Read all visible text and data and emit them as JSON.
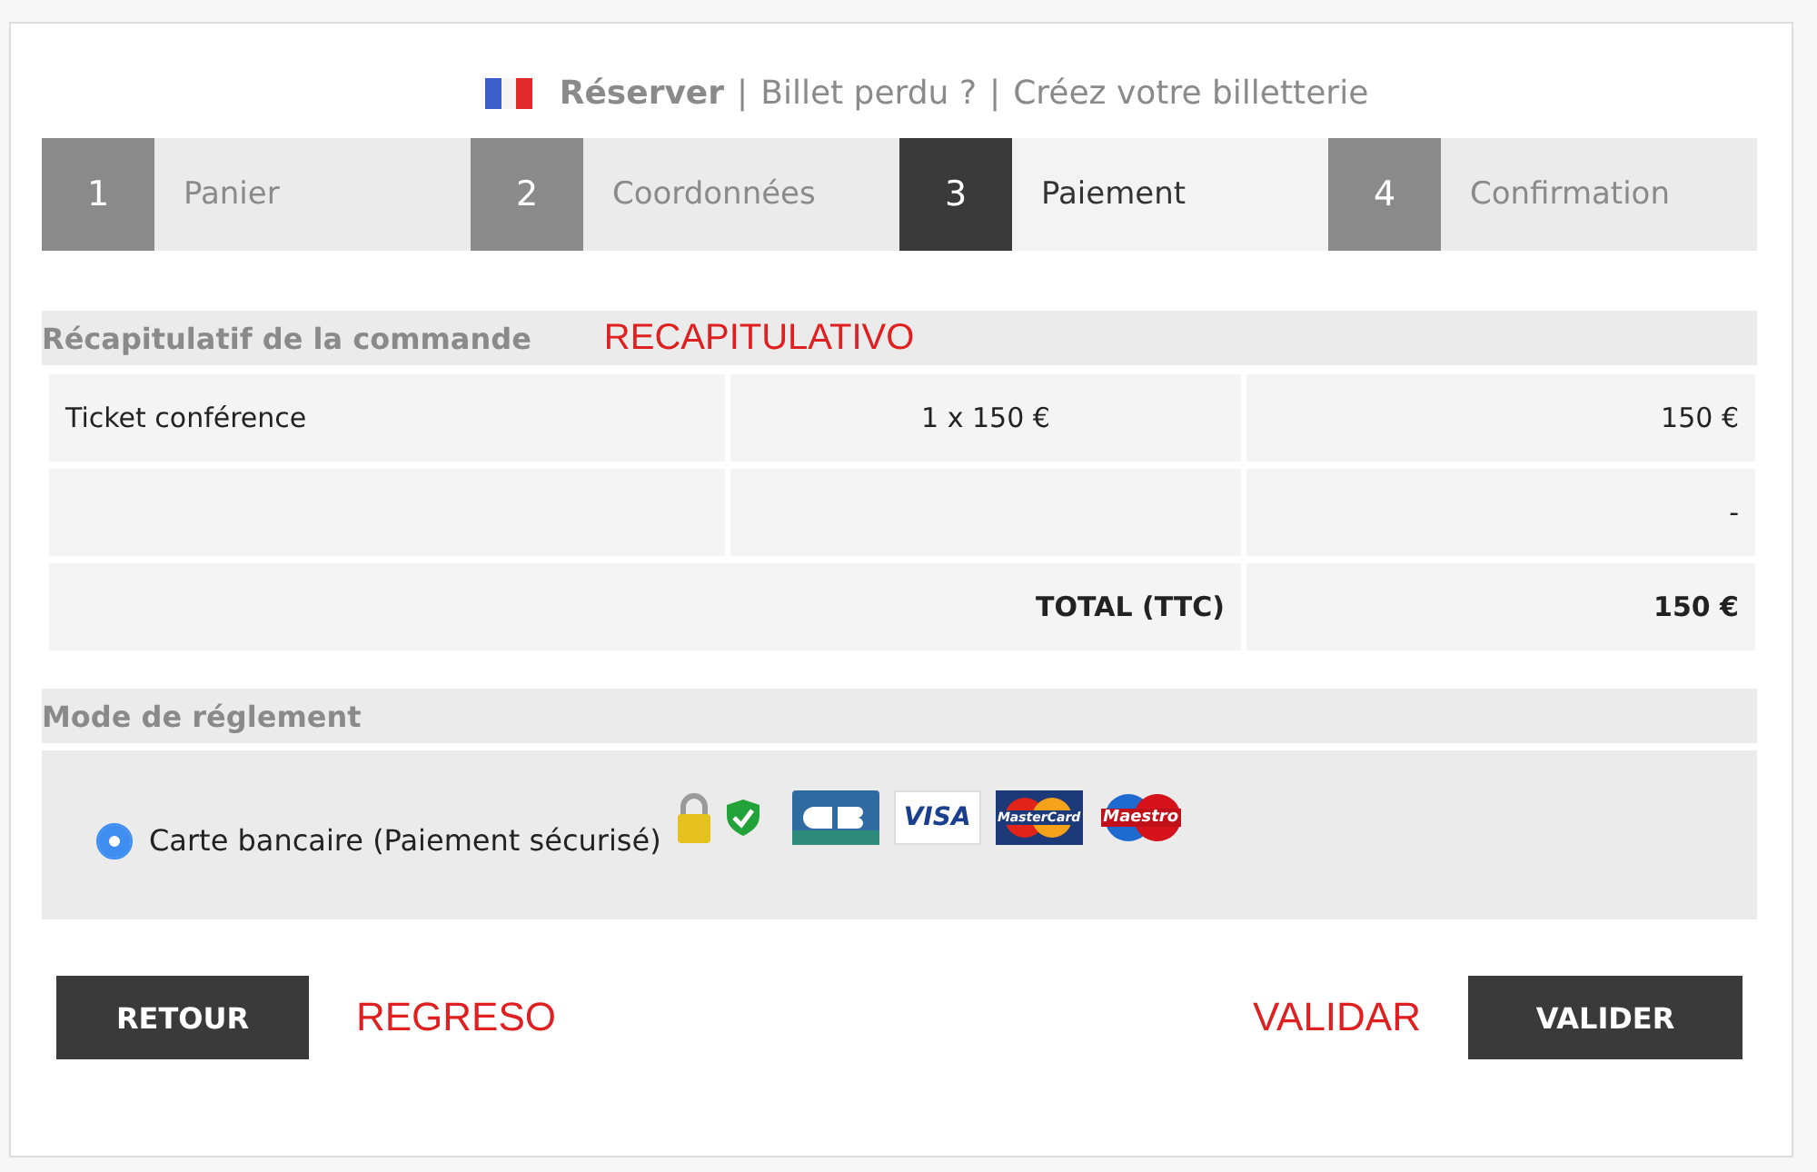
{
  "header": {
    "links": [
      {
        "label": "Réserver",
        "selected": true
      },
      {
        "separator": "|",
        "label": "Billet perdu ?",
        "selected": false
      },
      {
        "separator": "|",
        "label": "Créez votre billetterie",
        "selected": false
      }
    ]
  },
  "steps": [
    {
      "number": "1",
      "label": "Panier",
      "selected": false
    },
    {
      "number": "2",
      "label": "Coordonnées",
      "selected": false
    },
    {
      "number": "3",
      "label": "Paiement",
      "selected": true
    },
    {
      "number": "4",
      "label": "Confirmation",
      "selected": false
    }
  ],
  "summary": {
    "title": "Récapitulatif de la commande",
    "annotation": "RECAPITULATIVO",
    "rows": [
      {
        "cells": [
          "Ticket conférence",
          "1 x 150 €",
          "150 €"
        ],
        "kind": "item"
      },
      {
        "cells": [
          "",
          "",
          "-"
        ],
        "kind": "item"
      },
      {
        "cells": [
          "",
          "TOTAL (TTC)",
          "150 €"
        ],
        "kind": "total"
      }
    ]
  },
  "payment": {
    "title": "Mode de réglement",
    "options": [
      {
        "label": "Carte bancaire (Paiement sécurisé)",
        "selected": true
      }
    ],
    "cards": [
      {
        "kind": "cb"
      },
      {
        "kind": "visa",
        "label": "VISA"
      },
      {
        "kind": "mastercard",
        "label": "MasterCard"
      },
      {
        "kind": "maestro",
        "label": "Maestro"
      }
    ]
  },
  "actions": {
    "back": {
      "label": "RETOUR",
      "annotation": "REGRESO"
    },
    "next": {
      "label": "VALIDER",
      "annotation": "VALIDAR"
    }
  }
}
